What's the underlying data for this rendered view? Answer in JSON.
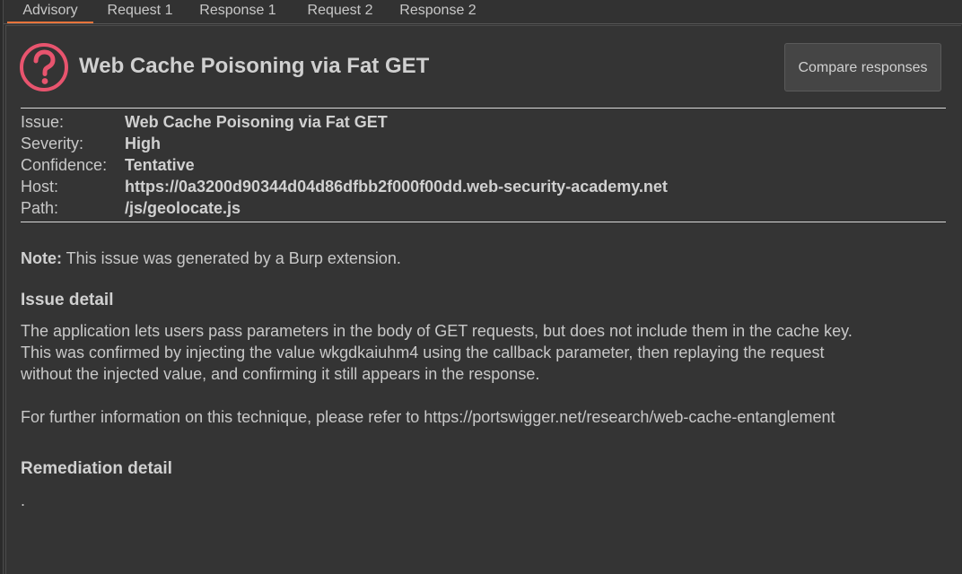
{
  "tabs": [
    {
      "label": "Advisory",
      "active": true
    },
    {
      "label": "Request 1",
      "active": false
    },
    {
      "label": "Response 1",
      "active": false
    },
    {
      "label": "Request 2",
      "active": false
    },
    {
      "label": "Response 2",
      "active": false
    }
  ],
  "advisory": {
    "title": "Web Cache Poisoning via Fat GET",
    "compare_button": "Compare responses",
    "icon": "question-circle-icon",
    "icon_color": "#e8546e",
    "accent_color": "#e8743b",
    "meta": [
      {
        "label": "Issue:",
        "value": "Web Cache Poisoning via Fat GET"
      },
      {
        "label": "Severity:",
        "value": "High"
      },
      {
        "label": "Confidence:",
        "value": "Tentative"
      },
      {
        "label": "Host:",
        "value": "https://0a3200d90344d04d86dfbb2f000f00dd.web-security-academy.net"
      },
      {
        "label": "Path:",
        "value": "/js/geolocate.js"
      }
    ],
    "note_label": "Note:",
    "note_text": " This issue was generated by a Burp extension.",
    "issue_detail_heading": "Issue detail",
    "issue_detail_lines": [
      "The application lets users pass parameters in the body of GET requests, but does not include them in the cache key.",
      "This was confirmed by injecting the value wkgdkaiuhm4 using the callback parameter, then replaying the request",
      "without the injected value, and confirming it still appears in the response."
    ],
    "further_info": "For further information on this technique, please refer to https://portswigger.net/research/web-cache-entanglement",
    "remediation_heading": "Remediation detail",
    "remediation_text": "."
  }
}
